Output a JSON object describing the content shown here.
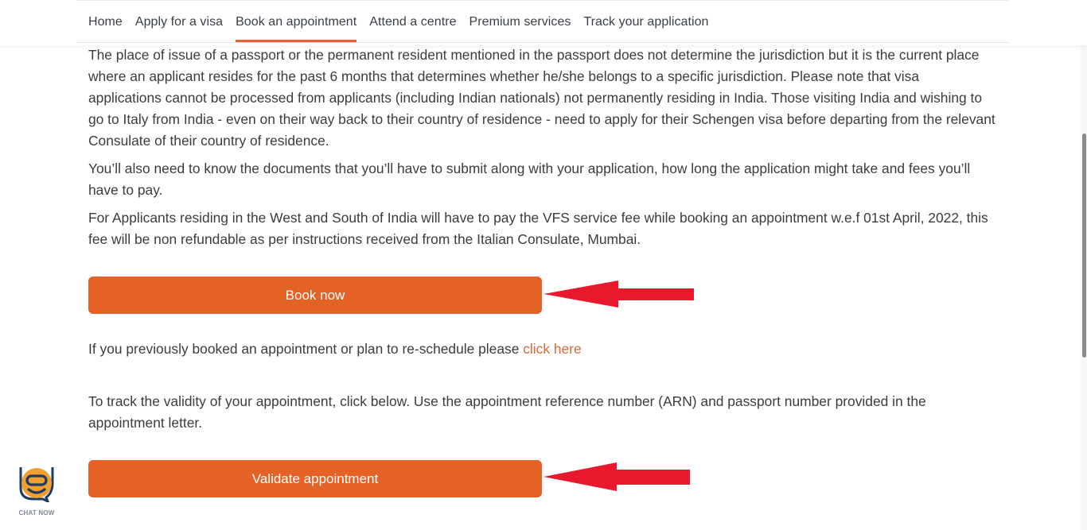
{
  "nav": {
    "items": [
      {
        "label": "Home",
        "active": false
      },
      {
        "label": "Apply for a visa",
        "active": false
      },
      {
        "label": "Book an appointment",
        "active": true
      },
      {
        "label": "Attend a centre",
        "active": false
      },
      {
        "label": "Premium services",
        "active": false
      },
      {
        "label": "Track your application",
        "active": false
      }
    ]
  },
  "content": {
    "paragraph_1": "The place of issue of a passport or the permanent resident mentioned in the passport does not determine the jurisdiction but it is the current place where an applicant resides for the past 6 months that determines whether he/she belongs to a specific jurisdiction. Please note that visa applications cannot be processed from applicants (including Indian nationals) not permanently residing in India. Those visiting India and wishing to go to Italy from India - even on their way back to their country of residence - need to apply for their Schengen visa before departing from the relevant Consulate of their country of residence.",
    "paragraph_2": "You’ll also need to know the documents that you’ll have to submit along with your application, how long the application might take and fees you’ll have to pay.",
    "paragraph_3": "For Applicants residing in the West and South of India will have to pay the VFS service fee while booking an appointment w.e.f 01st April, 2022, this fee will be non refundable as per instructions received from the Italian Consulate, Mumbai.",
    "book_now_label": "Book now",
    "reschedule_text": "If you previously booked an appointment or plan to re-schedule please ",
    "reschedule_link": "click here",
    "track_text": "To track the validity of your appointment, click below. Use the appointment reference number (ARN) and passport number provided in the appointment letter.",
    "validate_label": "Validate appointment"
  },
  "chat": {
    "label": "CHAT NOW",
    "icon": "chatbot-icon"
  },
  "colors": {
    "accent": "#e46225",
    "nav_underline": "#d36a35",
    "link": "#d86a3c",
    "annotation_arrow": "#e8192c",
    "chat_orange": "#f0a030",
    "chat_navy": "#1f3a5f"
  }
}
